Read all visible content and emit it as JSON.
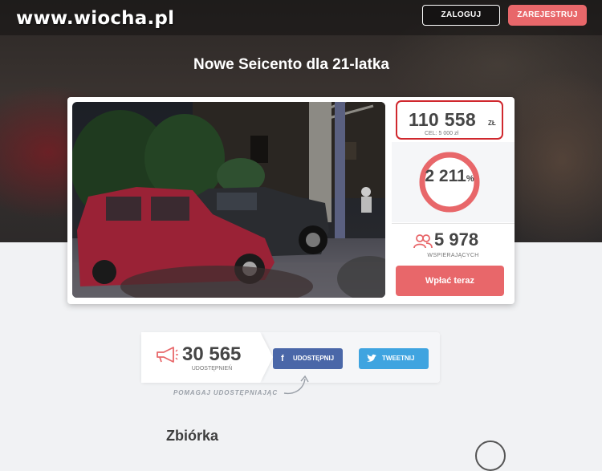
{
  "header": {
    "logo": "www.wiocha.pl",
    "login_label": "ZALOGUJ",
    "register_label": "ZAREJESTRUJ"
  },
  "campaign": {
    "title": "Nowe Seicento dla 21-latka",
    "amount": "110 558",
    "currency": "ZŁ",
    "goal": "CEL: 5 000 zł",
    "percent": "2 211",
    "percent_sign": "%",
    "progress_fraction": 1.0,
    "supporters": "5 978",
    "supporters_label": "WSPIERAJĄCYCH",
    "pay_label": "Wpłać teraz"
  },
  "share": {
    "count": "30 565",
    "count_label": "UDOSTĘPNIEŃ",
    "facebook_label": "UDOSTĘPNIJ",
    "twitter_label": "TWEETNIJ",
    "hint": "POMAGAJ UDOSTĘPNIAJĄC"
  },
  "section": {
    "title": "Zbiórka"
  },
  "colors": {
    "accent": "#e8676a",
    "facebook": "#4a67a8",
    "twitter": "#3fa4e0",
    "highlight": "#d0282e"
  },
  "icons": [
    "supporters-icon",
    "megaphone-icon",
    "facebook-icon",
    "twitter-icon",
    "curved-arrow-icon"
  ]
}
